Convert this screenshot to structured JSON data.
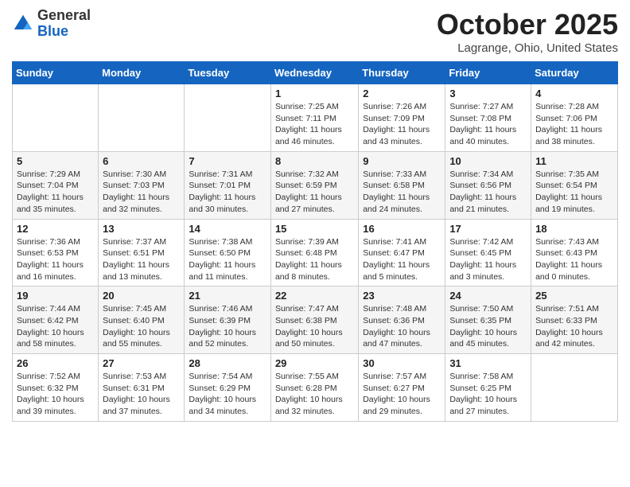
{
  "header": {
    "logo_general": "General",
    "logo_blue": "Blue",
    "month": "October 2025",
    "location": "Lagrange, Ohio, United States"
  },
  "days_of_week": [
    "Sunday",
    "Monday",
    "Tuesday",
    "Wednesday",
    "Thursday",
    "Friday",
    "Saturday"
  ],
  "weeks": [
    [
      {
        "day": "",
        "info": ""
      },
      {
        "day": "",
        "info": ""
      },
      {
        "day": "",
        "info": ""
      },
      {
        "day": "1",
        "info": "Sunrise: 7:25 AM\nSunset: 7:11 PM\nDaylight: 11 hours and 46 minutes."
      },
      {
        "day": "2",
        "info": "Sunrise: 7:26 AM\nSunset: 7:09 PM\nDaylight: 11 hours and 43 minutes."
      },
      {
        "day": "3",
        "info": "Sunrise: 7:27 AM\nSunset: 7:08 PM\nDaylight: 11 hours and 40 minutes."
      },
      {
        "day": "4",
        "info": "Sunrise: 7:28 AM\nSunset: 7:06 PM\nDaylight: 11 hours and 38 minutes."
      }
    ],
    [
      {
        "day": "5",
        "info": "Sunrise: 7:29 AM\nSunset: 7:04 PM\nDaylight: 11 hours and 35 minutes."
      },
      {
        "day": "6",
        "info": "Sunrise: 7:30 AM\nSunset: 7:03 PM\nDaylight: 11 hours and 32 minutes."
      },
      {
        "day": "7",
        "info": "Sunrise: 7:31 AM\nSunset: 7:01 PM\nDaylight: 11 hours and 30 minutes."
      },
      {
        "day": "8",
        "info": "Sunrise: 7:32 AM\nSunset: 6:59 PM\nDaylight: 11 hours and 27 minutes."
      },
      {
        "day": "9",
        "info": "Sunrise: 7:33 AM\nSunset: 6:58 PM\nDaylight: 11 hours and 24 minutes."
      },
      {
        "day": "10",
        "info": "Sunrise: 7:34 AM\nSunset: 6:56 PM\nDaylight: 11 hours and 21 minutes."
      },
      {
        "day": "11",
        "info": "Sunrise: 7:35 AM\nSunset: 6:54 PM\nDaylight: 11 hours and 19 minutes."
      }
    ],
    [
      {
        "day": "12",
        "info": "Sunrise: 7:36 AM\nSunset: 6:53 PM\nDaylight: 11 hours and 16 minutes."
      },
      {
        "day": "13",
        "info": "Sunrise: 7:37 AM\nSunset: 6:51 PM\nDaylight: 11 hours and 13 minutes."
      },
      {
        "day": "14",
        "info": "Sunrise: 7:38 AM\nSunset: 6:50 PM\nDaylight: 11 hours and 11 minutes."
      },
      {
        "day": "15",
        "info": "Sunrise: 7:39 AM\nSunset: 6:48 PM\nDaylight: 11 hours and 8 minutes."
      },
      {
        "day": "16",
        "info": "Sunrise: 7:41 AM\nSunset: 6:47 PM\nDaylight: 11 hours and 5 minutes."
      },
      {
        "day": "17",
        "info": "Sunrise: 7:42 AM\nSunset: 6:45 PM\nDaylight: 11 hours and 3 minutes."
      },
      {
        "day": "18",
        "info": "Sunrise: 7:43 AM\nSunset: 6:43 PM\nDaylight: 11 hours and 0 minutes."
      }
    ],
    [
      {
        "day": "19",
        "info": "Sunrise: 7:44 AM\nSunset: 6:42 PM\nDaylight: 10 hours and 58 minutes."
      },
      {
        "day": "20",
        "info": "Sunrise: 7:45 AM\nSunset: 6:40 PM\nDaylight: 10 hours and 55 minutes."
      },
      {
        "day": "21",
        "info": "Sunrise: 7:46 AM\nSunset: 6:39 PM\nDaylight: 10 hours and 52 minutes."
      },
      {
        "day": "22",
        "info": "Sunrise: 7:47 AM\nSunset: 6:38 PM\nDaylight: 10 hours and 50 minutes."
      },
      {
        "day": "23",
        "info": "Sunrise: 7:48 AM\nSunset: 6:36 PM\nDaylight: 10 hours and 47 minutes."
      },
      {
        "day": "24",
        "info": "Sunrise: 7:50 AM\nSunset: 6:35 PM\nDaylight: 10 hours and 45 minutes."
      },
      {
        "day": "25",
        "info": "Sunrise: 7:51 AM\nSunset: 6:33 PM\nDaylight: 10 hours and 42 minutes."
      }
    ],
    [
      {
        "day": "26",
        "info": "Sunrise: 7:52 AM\nSunset: 6:32 PM\nDaylight: 10 hours and 39 minutes."
      },
      {
        "day": "27",
        "info": "Sunrise: 7:53 AM\nSunset: 6:31 PM\nDaylight: 10 hours and 37 minutes."
      },
      {
        "day": "28",
        "info": "Sunrise: 7:54 AM\nSunset: 6:29 PM\nDaylight: 10 hours and 34 minutes."
      },
      {
        "day": "29",
        "info": "Sunrise: 7:55 AM\nSunset: 6:28 PM\nDaylight: 10 hours and 32 minutes."
      },
      {
        "day": "30",
        "info": "Sunrise: 7:57 AM\nSunset: 6:27 PM\nDaylight: 10 hours and 29 minutes."
      },
      {
        "day": "31",
        "info": "Sunrise: 7:58 AM\nSunset: 6:25 PM\nDaylight: 10 hours and 27 minutes."
      },
      {
        "day": "",
        "info": ""
      }
    ]
  ]
}
